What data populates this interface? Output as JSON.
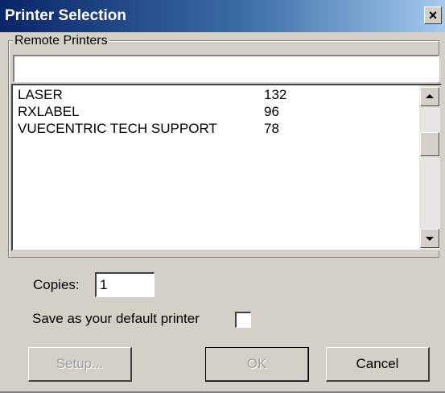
{
  "window": {
    "title": "Printer Selection",
    "close_glyph": "×",
    "close_icon": "close-icon"
  },
  "remote_printers": {
    "group_label": "Remote Printers",
    "filter_value": "",
    "rows": [
      {
        "name": "LASER",
        "count": "132"
      },
      {
        "name": "RXLABEL",
        "count": "96"
      },
      {
        "name": "VUECENTRIC TECH SUPPORT",
        "count": "78"
      }
    ]
  },
  "copies": {
    "label": "Copies:",
    "value": "1"
  },
  "default_printer": {
    "label": "Save as your default printer",
    "checked": false
  },
  "buttons": {
    "setup": "Setup...",
    "ok": "OK",
    "cancel": "Cancel"
  }
}
